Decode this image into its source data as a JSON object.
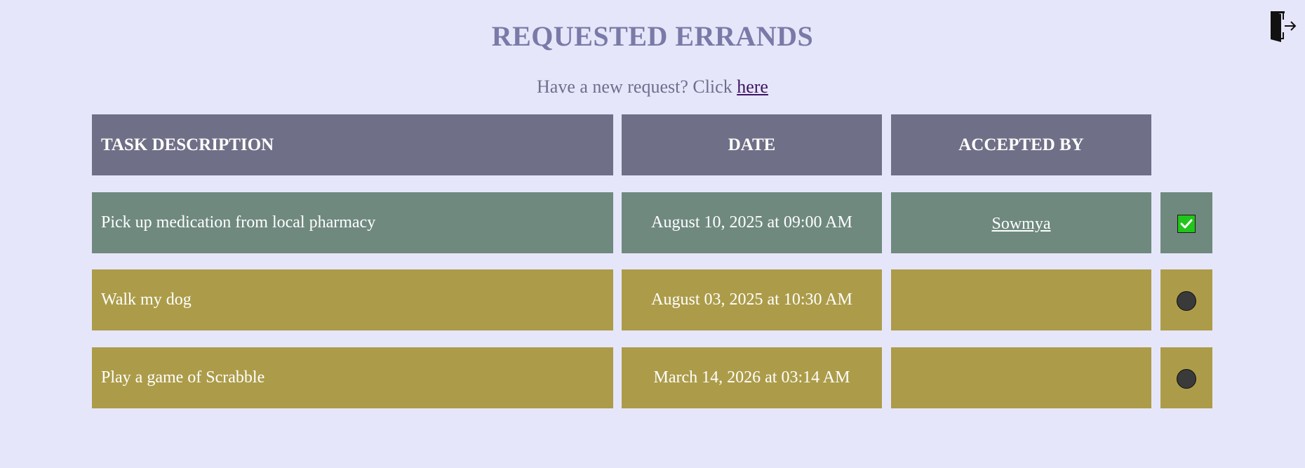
{
  "page": {
    "title": "REQUESTED ERRANDS",
    "subtitle_text": "Have a new request? Click ",
    "subtitle_link": "here"
  },
  "icons": {
    "logout": "logout-door-icon",
    "check": "checkmark-icon",
    "pending": "circle-icon"
  },
  "colors": {
    "background": "#e6e6fa",
    "title": "#7a7aa8",
    "header": "#6f6f87",
    "accepted_row": "#6f897f",
    "pending_row": "#ac9c49",
    "check_green": "#22c51a"
  },
  "table": {
    "headers": {
      "description": "TASK DESCRIPTION",
      "date": "DATE",
      "accepted_by": "ACCEPTED BY"
    },
    "rows": [
      {
        "description": "Pick up medication from local pharmacy",
        "date": "August 10, 2025 at 09:00 AM",
        "accepted_by": "Sowmya",
        "status": "accepted"
      },
      {
        "description": "Walk my dog",
        "date": "August 03, 2025 at 10:30 AM",
        "accepted_by": "",
        "status": "pending"
      },
      {
        "description": "Play a game of Scrabble",
        "date": "March 14, 2026 at 03:14 AM",
        "accepted_by": "",
        "status": "pending"
      }
    ]
  }
}
